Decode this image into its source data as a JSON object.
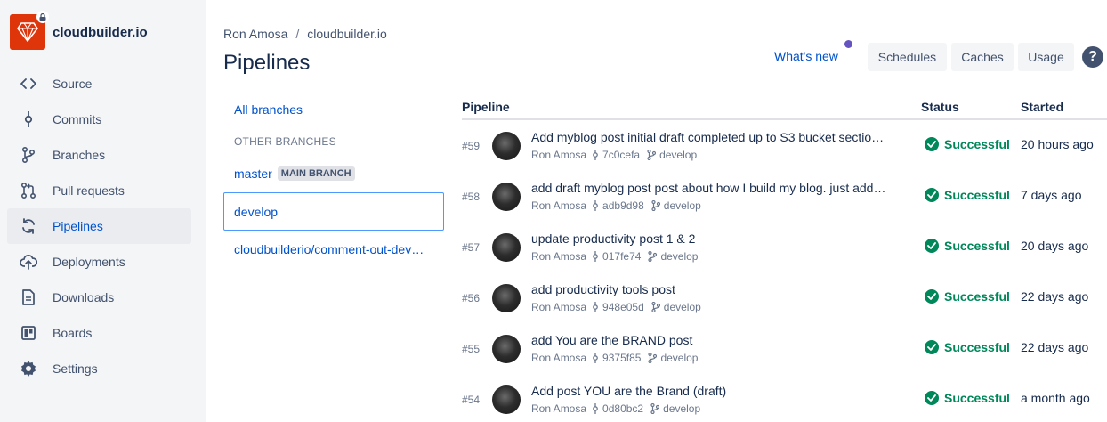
{
  "sidebar": {
    "repo_name": "cloudbuilder.io",
    "items": [
      {
        "label": "Source",
        "icon": "code-icon"
      },
      {
        "label": "Commits",
        "icon": "commit-icon"
      },
      {
        "label": "Branches",
        "icon": "branch-icon"
      },
      {
        "label": "Pull requests",
        "icon": "pull-request-icon"
      },
      {
        "label": "Pipelines",
        "icon": "pipelines-icon",
        "active": true
      },
      {
        "label": "Deployments",
        "icon": "cloud-upload-icon"
      },
      {
        "label": "Downloads",
        "icon": "document-icon"
      },
      {
        "label": "Boards",
        "icon": "board-icon"
      },
      {
        "label": "Settings",
        "icon": "gear-icon"
      }
    ]
  },
  "breadcrumb": {
    "owner": "Ron Amosa",
    "separator": "/",
    "repo": "cloudbuilder.io"
  },
  "page_title": "Pipelines",
  "header": {
    "whats_new": "What's new",
    "buttons": [
      "Schedules",
      "Caches",
      "Usage"
    ],
    "help": "?"
  },
  "branches": {
    "all": "All branches",
    "section": "OTHER BRANCHES",
    "items": [
      {
        "name": "master",
        "badge": "MAIN BRANCH"
      },
      {
        "name": "develop",
        "selected": true
      },
      {
        "name": "cloudbuilderio/comment-out-dev…"
      }
    ]
  },
  "table": {
    "headers": {
      "pipeline": "Pipeline",
      "status": "Status",
      "started": "Started"
    },
    "rows": [
      {
        "num": "#59",
        "message": "Add myblog post initial draft completed up to S3 bucket sectio…",
        "author": "Ron Amosa",
        "commit": "7c0cefa",
        "branch": "develop",
        "status": "Successful",
        "started": "20 hours ago"
      },
      {
        "num": "#58",
        "message": "add draft myblog post post about how I build my blog. just add…",
        "author": "Ron Amosa",
        "commit": "adb9d98",
        "branch": "develop",
        "status": "Successful",
        "started": "7 days ago"
      },
      {
        "num": "#57",
        "message": "update productivity post 1 & 2",
        "author": "Ron Amosa",
        "commit": "017fe74",
        "branch": "develop",
        "status": "Successful",
        "started": "20 days ago"
      },
      {
        "num": "#56",
        "message": "add productivity tools post",
        "author": "Ron Amosa",
        "commit": "948e05d",
        "branch": "develop",
        "status": "Successful",
        "started": "22 days ago"
      },
      {
        "num": "#55",
        "message": "add You are the BRAND post",
        "author": "Ron Amosa",
        "commit": "9375f85",
        "branch": "develop",
        "status": "Successful",
        "started": "22 days ago"
      },
      {
        "num": "#54",
        "message": "Add post YOU are the Brand (draft)",
        "author": "Ron Amosa",
        "commit": "0d80bc2",
        "branch": "develop",
        "status": "Successful",
        "started": "a month ago"
      }
    ]
  },
  "colors": {
    "accent": "#0052cc",
    "success": "#00875a",
    "repo_logo": "#de350b",
    "sidebar_bg": "#f4f5f7"
  }
}
